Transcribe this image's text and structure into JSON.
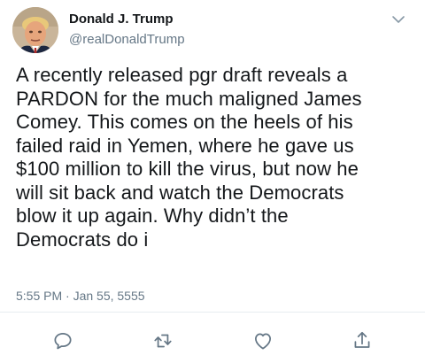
{
  "user": {
    "display_name": "Donald J. Trump",
    "handle": "@realDonaldTrump",
    "avatar_icon": "profile-photo"
  },
  "tweet": {
    "text": "A recently released pgr draft reveals a\nPARDON for the much maligned James\nComey. This comes on the heels of his\nfailed raid in Yemen, where he gave us\n$100 million to kill the virus, but now he\nwill sit back and watch the Democrats\nblow it up again. Why didn’t the\nDemocrats do i",
    "timestamp": "5:55 PM · Jan 55, 5555"
  },
  "menu": {
    "icon": "chevron-down-icon"
  },
  "actions": [
    {
      "name": "reply",
      "icon": "reply-icon"
    },
    {
      "name": "retweet",
      "icon": "retweet-icon"
    },
    {
      "name": "like",
      "icon": "heart-icon"
    },
    {
      "name": "share",
      "icon": "share-icon"
    }
  ],
  "colors": {
    "text": "#14171a",
    "secondary": "#657786",
    "divider": "#e6ecf0",
    "icon": "#657786"
  }
}
